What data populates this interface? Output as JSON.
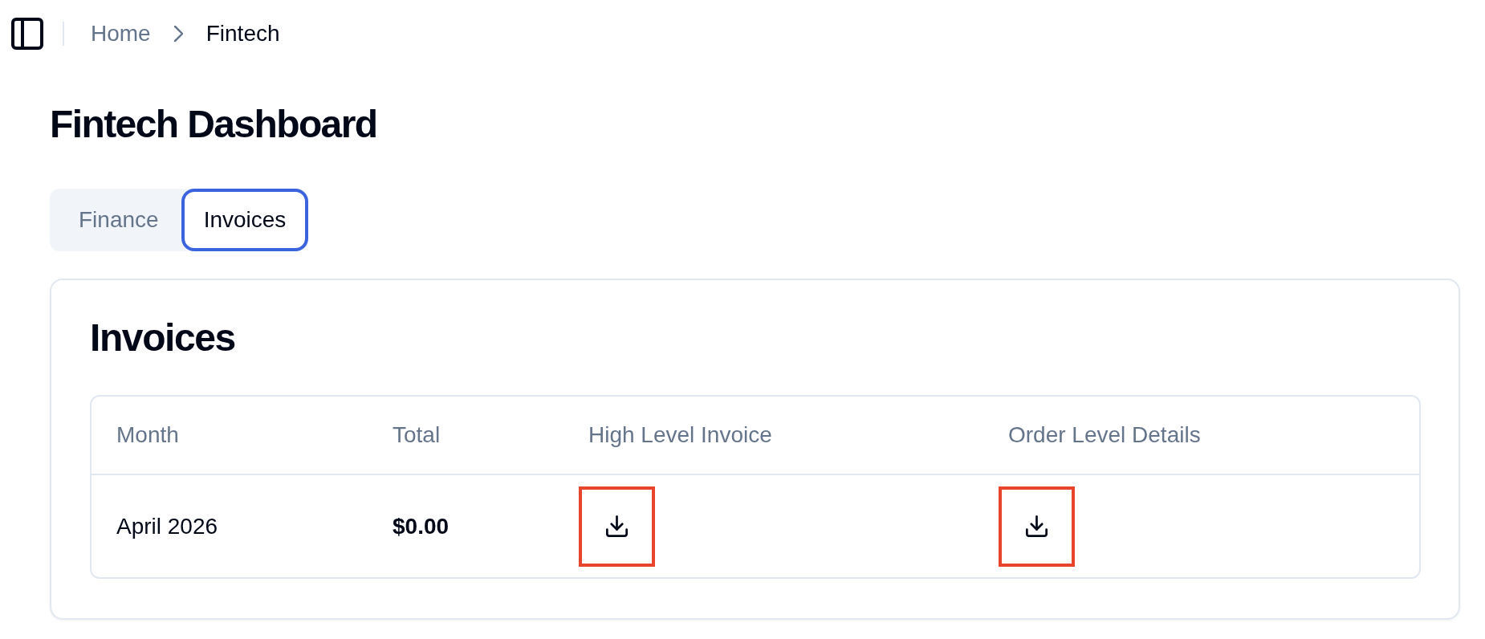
{
  "header": {
    "breadcrumb": [
      {
        "label": "Home",
        "current": false
      },
      {
        "label": "Fintech",
        "current": true
      }
    ]
  },
  "page": {
    "title": "Fintech Dashboard"
  },
  "tabs": [
    {
      "label": "Finance",
      "selected": false
    },
    {
      "label": "Invoices",
      "selected": true
    }
  ],
  "invoices_card": {
    "title": "Invoices",
    "table": {
      "columns": [
        "Month",
        "Total",
        "High Level Invoice",
        "Order Level Details"
      ],
      "rows": [
        {
          "cells": [
            {
              "kind": "text",
              "text": "April 2026"
            },
            {
              "kind": "amount",
              "text": "$0.00"
            },
            {
              "kind": "download",
              "highlighted": true
            },
            {
              "kind": "download",
              "highlighted": true
            }
          ]
        }
      ]
    }
  }
}
